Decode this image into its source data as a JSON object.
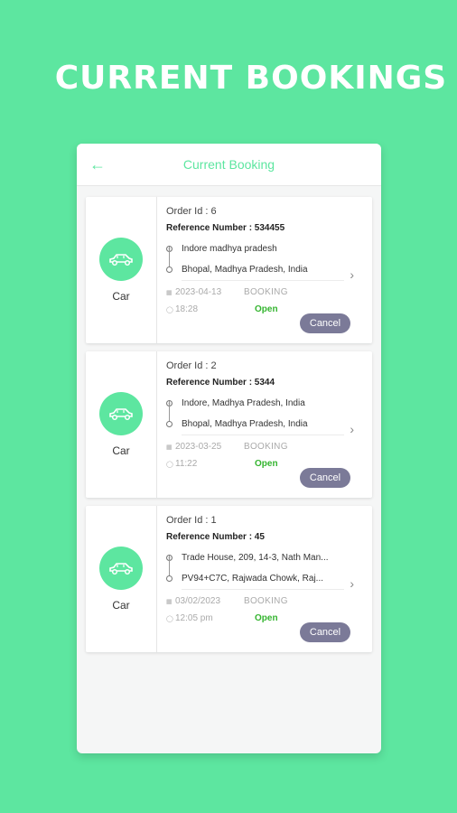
{
  "headline": "CURRENT BOOKINGS",
  "appbar": {
    "title": "Current Booking",
    "back_icon": "arrow-left-icon"
  },
  "colors": {
    "accent": "#5de6a0",
    "cancel": "#7b7a98",
    "open": "#35b530"
  },
  "bookings": [
    {
      "vehicle": "Car",
      "order_id": "Order Id : 6",
      "reference": "Reference Number : 534455",
      "pickup": "Indore madhya pradesh",
      "drop": "Bhopal, Madhya Pradesh, India",
      "date": "2023-04-13",
      "status": "BOOKING",
      "time": "18:28",
      "state": "Open",
      "cancel_label": "Cancel"
    },
    {
      "vehicle": "Car",
      "order_id": "Order Id : 2",
      "reference": "Reference Number : 5344",
      "pickup": "Indore, Madhya Pradesh, India",
      "drop": "Bhopal, Madhya Pradesh, India",
      "date": "2023-03-25",
      "status": "BOOKING",
      "time": "11:22",
      "state": "Open",
      "cancel_label": "Cancel"
    },
    {
      "vehicle": "Car",
      "order_id": "Order Id : 1",
      "reference": "Reference Number : 45",
      "pickup": "Trade House, 209, 14-3, Nath Man...",
      "drop": "PV94+C7C, Rajwada Chowk, Raj...",
      "date": "03/02/2023",
      "status": "BOOKING",
      "time": "12:05 pm",
      "state": "Open",
      "cancel_label": "Cancel"
    }
  ]
}
